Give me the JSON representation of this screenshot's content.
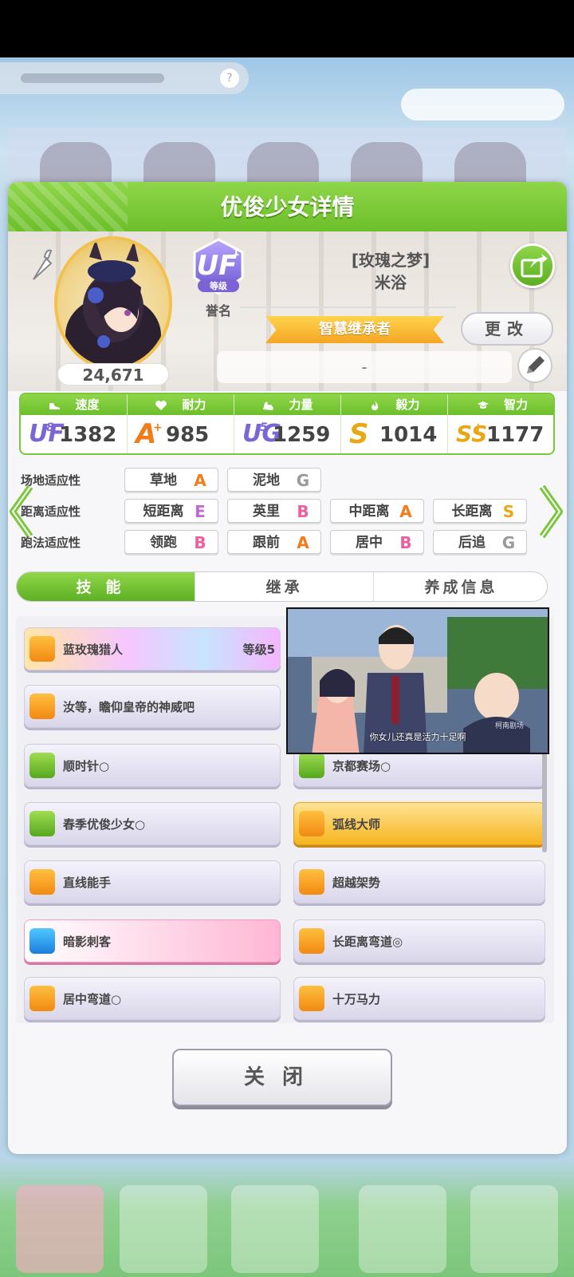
{
  "panel": {
    "title": "优俊少女详情"
  },
  "profile": {
    "fans": "24,671",
    "rank_badge": "UF",
    "rank_badge_sub": "1",
    "rank_badge_small": "等级",
    "rank_label": "誉名",
    "epithet": "[玫瑰之梦]",
    "name": "米浴",
    "title": "智慧继承者",
    "change_label": "更改",
    "comment": "-"
  },
  "stats": [
    {
      "label": "速度",
      "grade": "UF",
      "grade_sup": "8",
      "value": "1382",
      "icon": "shoe-icon"
    },
    {
      "label": "耐力",
      "grade": "A",
      "grade_sup": "+",
      "value": "985",
      "icon": "heart-icon"
    },
    {
      "label": "力量",
      "grade": "UG",
      "grade_sup": "5",
      "value": "1259",
      "icon": "muscle-icon"
    },
    {
      "label": "毅力",
      "grade": "S",
      "grade_sup": "",
      "value": "1014",
      "icon": "flame-icon"
    },
    {
      "label": "智力",
      "grade": "SS",
      "grade_sup": "+",
      "value": "1177",
      "icon": "graduation-cap-icon"
    }
  ],
  "aptitude": {
    "track_label": "场地适应性",
    "distance_label": "距离适应性",
    "style_label": "跑法适应性",
    "track": [
      {
        "name": "草地",
        "grade": "A"
      },
      {
        "name": "泥地",
        "grade": "G"
      }
    ],
    "distance": [
      {
        "name": "短距离",
        "grade": "E"
      },
      {
        "name": "英里",
        "grade": "B"
      },
      {
        "name": "中距离",
        "grade": "A"
      },
      {
        "name": "长距离",
        "grade": "S"
      }
    ],
    "style": [
      {
        "name": "领跑",
        "grade": "B"
      },
      {
        "name": "跟前",
        "grade": "A"
      },
      {
        "name": "居中",
        "grade": "B"
      },
      {
        "name": "后追",
        "grade": "G"
      }
    ]
  },
  "tabs": [
    "技能",
    "继承",
    "养成信息"
  ],
  "skills": [
    {
      "name": "蓝玫瑰猎人",
      "level": "等级5"
    },
    {
      "name": "汝等，瞻仰皇帝的神威吧"
    },
    {
      "name": "顺时针○"
    },
    {
      "name": "京都赛场○"
    },
    {
      "name": "春季优俊少女○"
    },
    {
      "name": "弧线大师"
    },
    {
      "name": "直线能手"
    },
    {
      "name": "超越架势"
    },
    {
      "name": "暗影刺客"
    },
    {
      "name": "长距离弯道◎"
    },
    {
      "name": "居中弯道○"
    },
    {
      "name": "十万马力"
    }
  ],
  "video": {
    "caption": "你女儿还真是活力十足啊",
    "tag": "柯南剧场"
  },
  "close_label": "关闭",
  "colors": {
    "accent_green": "#6cbf2a",
    "grade_orange": "#f37b18",
    "grade_gold": "#e9a716",
    "grade_purple": "#7a66d6"
  }
}
